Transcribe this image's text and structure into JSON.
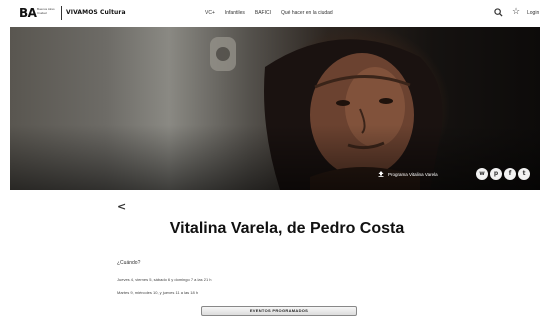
{
  "header": {
    "logo_ba": "BA",
    "logo_ba_sub": "Buenos Aires Ciudad",
    "logo_vivamos": "VIVAMOS Cultura",
    "nav": [
      "VC+",
      "Infantiles",
      "BAFICI",
      "Qué hacer en la ciudad"
    ],
    "login": "Login",
    "icons": [
      "search-icon",
      "star-icon"
    ]
  },
  "hero": {
    "caption": "Programa Vitalina Varela",
    "caption_icon": "upload-icon",
    "share": [
      "whatsapp-icon",
      "pinterest-icon",
      "facebook-icon",
      "twitter-icon"
    ]
  },
  "main": {
    "back": "<",
    "title": "Vitalina Varela, de Pedro Costa",
    "when_label": "¿Cuándo?",
    "schedule_1": "Jueves 4, viernes 5, sábado 6 y domingo 7 a las 21 h",
    "schedule_2": "Martes 9, miércoles 10, y jueves 11 a las 18 h",
    "events_button": "EVENTOS PROGRAMADOS"
  },
  "colors": {
    "background": "#ffffff",
    "text": "#222222",
    "hero_dark": "#0d0b0a"
  }
}
